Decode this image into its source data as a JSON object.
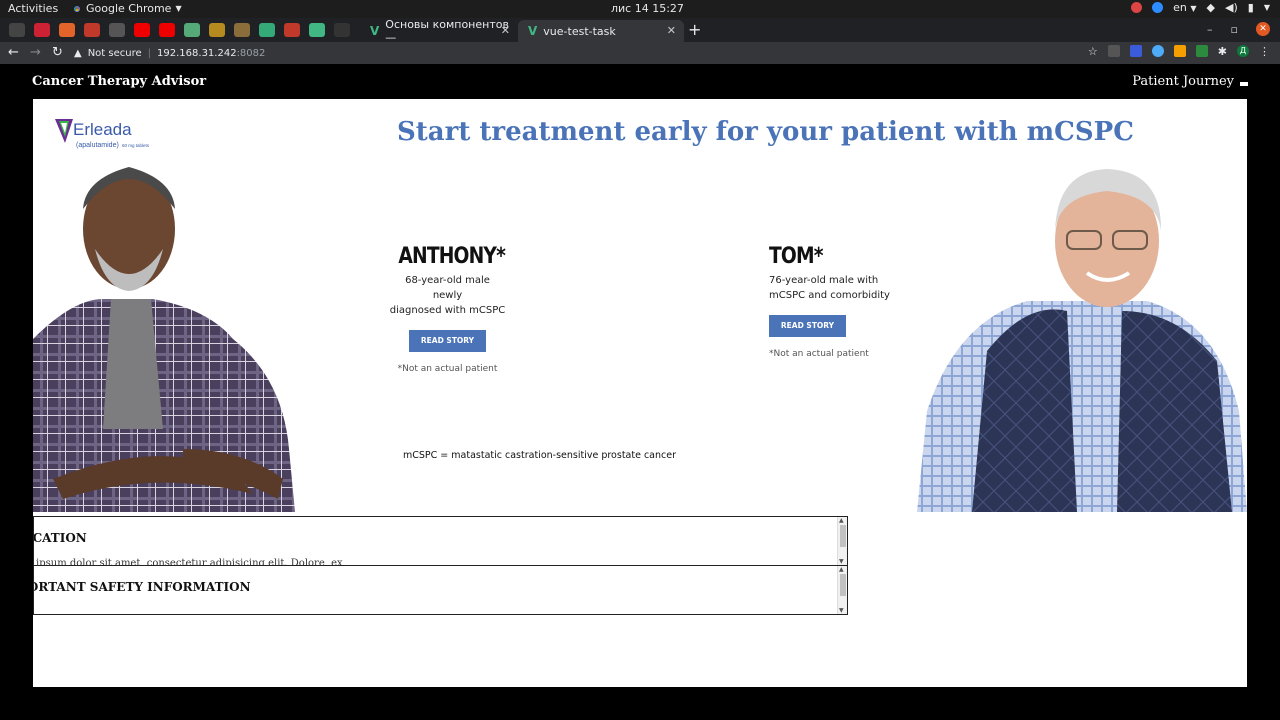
{
  "gnome": {
    "activities": "Activities",
    "app_name": "Google Chrome",
    "clock": "лис 14  15:27",
    "lang": "en"
  },
  "browser": {
    "tabs": [
      {
        "label": "Основы компонентов —",
        "active": false
      },
      {
        "label": "vue-test-task",
        "active": true
      }
    ],
    "security": "Not secure",
    "url_host": "192.168.31.242",
    "url_port": ":8082",
    "profile_initial": "Д"
  },
  "site": {
    "title": "Cancer Therapy Advisor",
    "nav_label": "Patient Journey"
  },
  "hero": {
    "brand": "Erleada",
    "brand_sub": "(apalutamide)",
    "brand_dose": "60 mg tablets",
    "headline": "Start treatment early for your patient with mCSPC",
    "patients": [
      {
        "name": "ANTHONY*",
        "desc_line1": "68-year-old male newly",
        "desc_line2": "diagnosed with mCSPC",
        "button": "READ STORY",
        "note": "*Not an actual patient"
      },
      {
        "name": "TOM*",
        "desc_line1": "76-year-old male with",
        "desc_line2": "mCSPC and comorbidity",
        "button": "READ STORY",
        "note": "*Not an actual patient"
      }
    ],
    "abbreviation": "mCSPC = matastatic castration-sensitive prostate cancer"
  },
  "info": {
    "indication_title": "INDICATION",
    "indication_body": "Lorem ipsum dolor sit amet, consectetur adipisicing elit. Dolore, ex",
    "safety_title": "IMPORTANT SAFETY INFORMATION"
  },
  "colors": {
    "accent": "#4a73b8",
    "vue": "#41b883",
    "chrome_dark": "#202124",
    "toolbar": "#35363a"
  }
}
